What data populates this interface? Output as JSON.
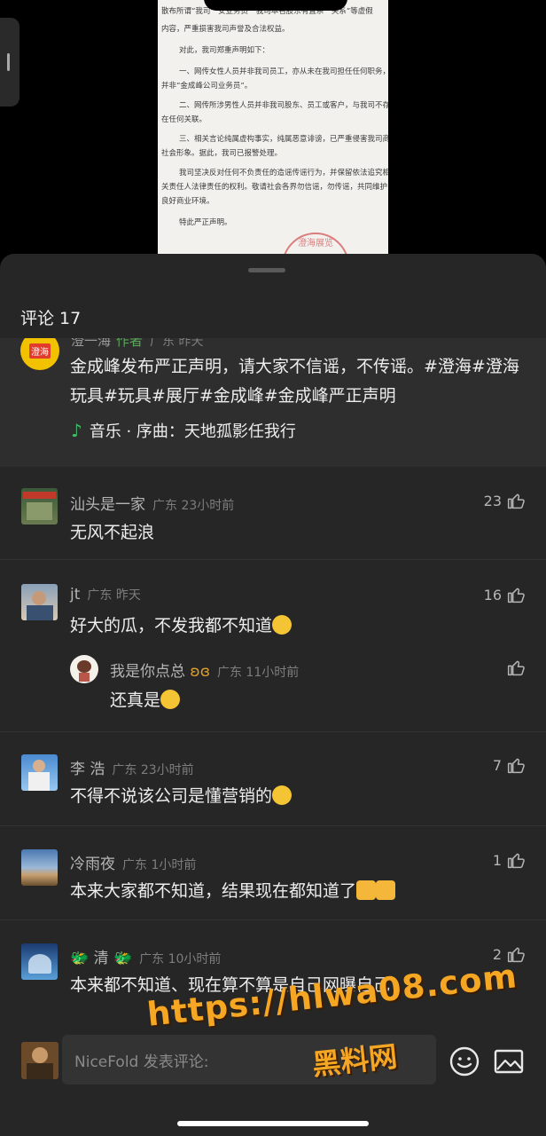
{
  "document": {
    "lines": [
      "散布所谓“我司”“安业务员”“我司本名股东有直系”“关系”等虚假",
      "内容，严重损害我司声誉及合法权益。",
      "对此，我司郑重声明如下：",
      "一、网传女性人员并非我司员工，亦从未在我司担任任何职务，",
      "并非“金成峰公司业务员”。",
      "二、网传所涉男性人员并非我司股东、员工或客户，与我司不存",
      "在任何关联。",
      "三、相关言论纯属虚构事实，纯属恶意诽谤，已严重侵害我司商誉及",
      "社会形象。据此，我司已报警处理。",
      "我司坚决反对任何不负责任的造谣传谣行为，并保留依法追究相",
      "关责任人法律责任的权利。敬请社会各界勿信谣，勿传谣，共同维护",
      "良好商业环境。",
      "特此严正声明。"
    ],
    "seal_text": "澄海展览"
  },
  "sheet": {
    "title": "评论 17"
  },
  "author_post": {
    "avatar_text": "澄海",
    "name": "澄一海",
    "tag": "作者",
    "meta": "广东 昨天",
    "text": "金成峰发布严正声明，请大家不信谣，不传谣。#澄海#澄海玩具#玩具#展厅#金成峰#金成峰严正声明",
    "music": "音乐 · 序曲：天地孤影任我行"
  },
  "comments": [
    {
      "name": "汕头是一家",
      "meta": "广东 23小时前",
      "text": "无风不起浪",
      "likes": "23"
    },
    {
      "name": "jt",
      "meta": "广东 昨天",
      "text": "好大的瓜，不发我都不知道",
      "likes": "16",
      "reply": {
        "name": "我是你点总",
        "meta": "广东 11小时前",
        "text": "还真是",
        "likes": ""
      }
    },
    {
      "name": "李 浩",
      "meta": "广东 23小时前",
      "text": "不得不说该公司是懂营销的",
      "likes": "7"
    },
    {
      "name": "冷雨夜",
      "meta": "广东 1小时前",
      "text": "本来大家都不知道，结果现在都知道了",
      "likes": "1"
    },
    {
      "name": "清",
      "meta": "广东 10小时前",
      "text": "本来都不知道、现在算不算是自己网曝自己",
      "likes": "2"
    }
  ],
  "input": {
    "placeholder": "NiceFold 发表评论:"
  },
  "watermark": {
    "url": "https://hlwa08.com",
    "name": "黑料网"
  },
  "colors": {
    "background": "#262626",
    "author_block": "#2e2e2e",
    "accent_green": "#3fc06a",
    "watermark": "#f5a623"
  }
}
